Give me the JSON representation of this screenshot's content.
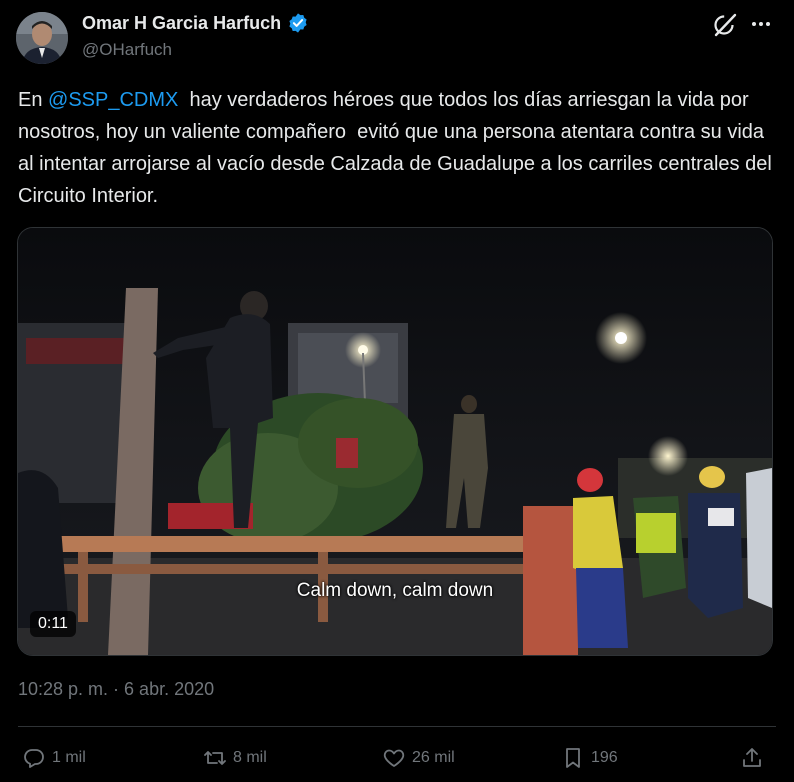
{
  "author": {
    "display_name": "Omar H Garcia Harfuch",
    "handle": "@OHarfuch",
    "verified_color": "#1d9bf0"
  },
  "tweet": {
    "text_before": "En ",
    "mention": "@SSP_CDMX",
    "text_after": "  hay verdaderos héroes que todos los días arriesgan la vida por nosotros, hoy un valiente compañero  evitó que una persona atentara contra su vida al intentar arrojarse al vacío desde Calzada de Guadalupe a los carriles centrales del Circuito Interior."
  },
  "video": {
    "caption": "Calm down, calm down",
    "duration": "0:11"
  },
  "timestamp": "10:28 p. m. · 6 abr. 2020",
  "actions": {
    "replies": "1 mil",
    "reposts": "8 mil",
    "likes": "26 mil",
    "bookmarks": "196"
  },
  "icons": {
    "top_right": [
      "grok-icon",
      "more-icon"
    ],
    "action_bar": [
      "reply-icon",
      "repost-icon",
      "like-icon",
      "bookmark-icon",
      "share-icon"
    ]
  },
  "colors": {
    "background": "#000000",
    "text": "#e7e9ea",
    "secondary": "#71767b",
    "link": "#1d9bf0",
    "divider": "#2f3336"
  }
}
